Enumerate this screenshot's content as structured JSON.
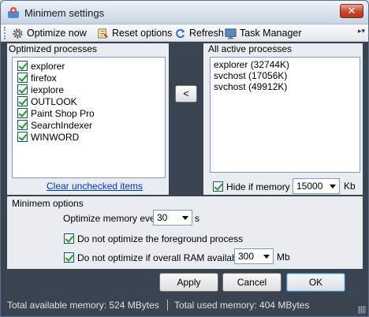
{
  "window": {
    "title": "Minimem settings"
  },
  "toolbar": {
    "optimize_now": "Optimize now",
    "reset_options": "Reset options",
    "refresh": "Refresh",
    "task_manager": "Task Manager"
  },
  "optimized": {
    "label": "Optimized processes",
    "items": [
      {
        "name": "explorer",
        "checked": true
      },
      {
        "name": "firefox",
        "checked": true
      },
      {
        "name": "iexplore",
        "checked": true
      },
      {
        "name": "OUTLOOK",
        "checked": true
      },
      {
        "name": "Paint Shop Pro",
        "checked": true
      },
      {
        "name": "SearchIndexer",
        "checked": true
      },
      {
        "name": "WINWORD",
        "checked": true
      }
    ],
    "clear_link": "Clear unchecked items"
  },
  "move_button": "<",
  "active": {
    "label": "All active processes",
    "items": [
      "explorer (32744K)",
      "svchost (17056K)",
      "svchost (49912K)"
    ],
    "hide_label": "Hide if memory <",
    "hide_value": "15000",
    "hide_unit": "Kb"
  },
  "options": {
    "label": "Minimem options",
    "every_label": "Optimize memory every",
    "every_value": "30",
    "every_unit": "s",
    "foreground_label": "Do not optimize the foreground process",
    "ram_label": "Do not optimize if overall RAM available >",
    "ram_value": "300",
    "ram_unit": "Mb"
  },
  "buttons": {
    "apply": "Apply",
    "cancel": "Cancel",
    "ok": "OK"
  },
  "status": {
    "available": "Total available memory: 524 MBytes",
    "used": "Total used memory: 404 MBytes"
  },
  "colors": {
    "dark_panel": "#3a4350",
    "link": "#0033cc",
    "check": "#21a121"
  }
}
